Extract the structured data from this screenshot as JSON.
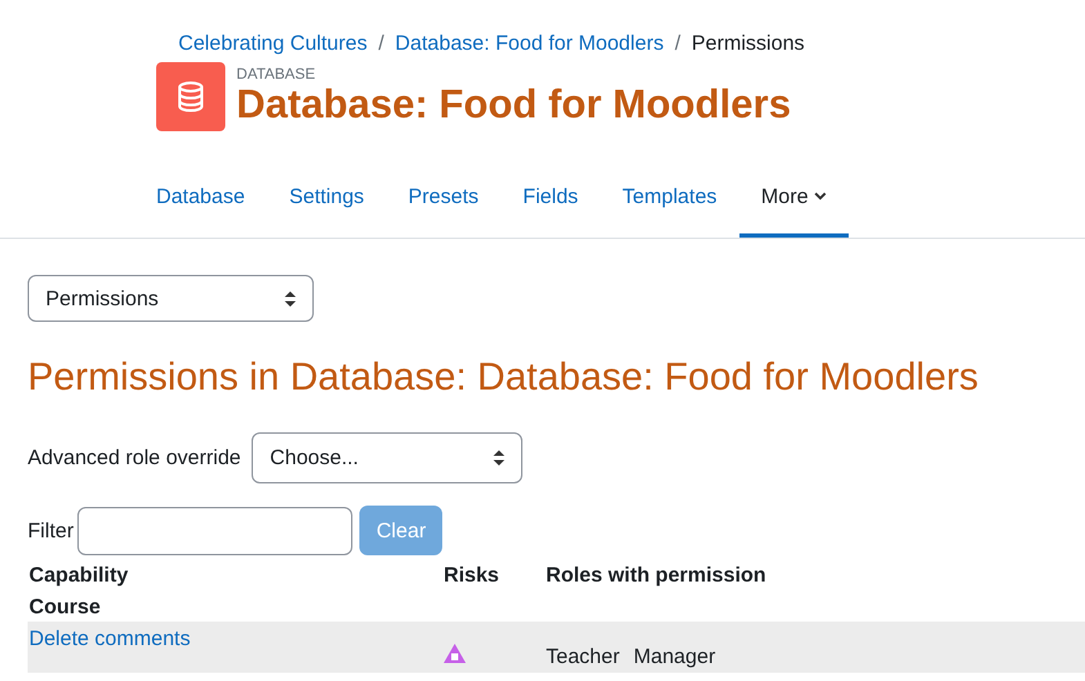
{
  "breadcrumb": [
    {
      "kind": "link",
      "label": "Celebrating Cultures"
    },
    {
      "kind": "separator",
      "label": "/"
    },
    {
      "kind": "link",
      "label": "Database: Food for Moodlers"
    },
    {
      "kind": "separator",
      "label": "/"
    },
    {
      "kind": "current",
      "label": "Permissions"
    }
  ],
  "header": {
    "module_type": "DATABASE",
    "title": "Database: Food for Moodlers"
  },
  "tabs": [
    {
      "label": "Database",
      "selected": false,
      "dropdown": false
    },
    {
      "label": "Settings",
      "selected": false,
      "dropdown": false
    },
    {
      "label": "Presets",
      "selected": false,
      "dropdown": false
    },
    {
      "label": "Fields",
      "selected": false,
      "dropdown": false
    },
    {
      "label": "Templates",
      "selected": false,
      "dropdown": false
    },
    {
      "label": "More",
      "selected": true,
      "dropdown": true
    }
  ],
  "page_select": {
    "value": "Permissions"
  },
  "heading": "Permissions in Database: Database: Food for Moodlers",
  "role_override": {
    "label": "Advanced role override",
    "value": "Choose..."
  },
  "filter": {
    "label": "Filter",
    "button": "Clear"
  },
  "table": {
    "columns": [
      "Capability",
      "Risks",
      "Roles with permission"
    ],
    "section": "Course",
    "rows": [
      {
        "capability": "Delete comments",
        "risk": true,
        "roles": [
          "Teacher",
          "Manager"
        ]
      }
    ]
  }
}
